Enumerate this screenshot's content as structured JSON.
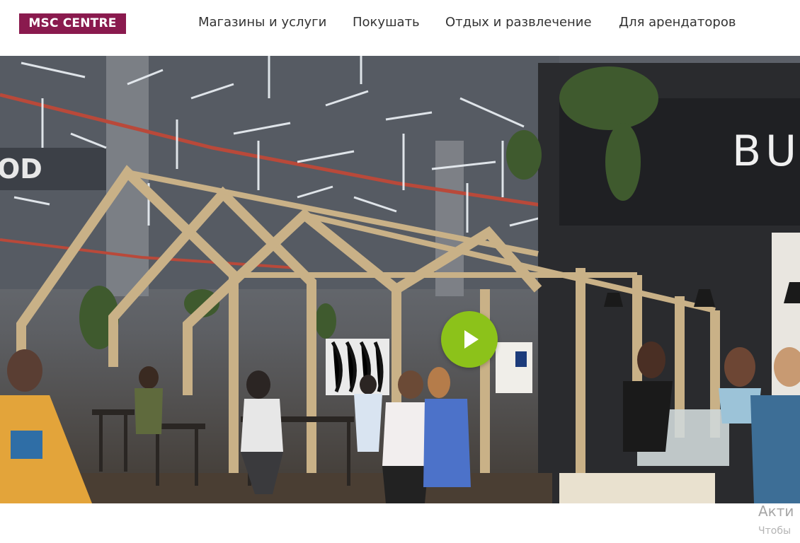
{
  "header": {
    "logo_text": "MSC CENTRE",
    "nav": [
      {
        "label": "Магазины и услуги"
      },
      {
        "label": "Покушать"
      },
      {
        "label": "Отдых и развлечение"
      },
      {
        "label": "Для арендаторов"
      }
    ]
  },
  "hero": {
    "signage_left": "OD",
    "signage_right": "BU",
    "brand_color": "#8a1a4e",
    "play_color": "#8cc21a"
  },
  "watermark": {
    "line1": "Акти",
    "line2": "Чтобы"
  }
}
